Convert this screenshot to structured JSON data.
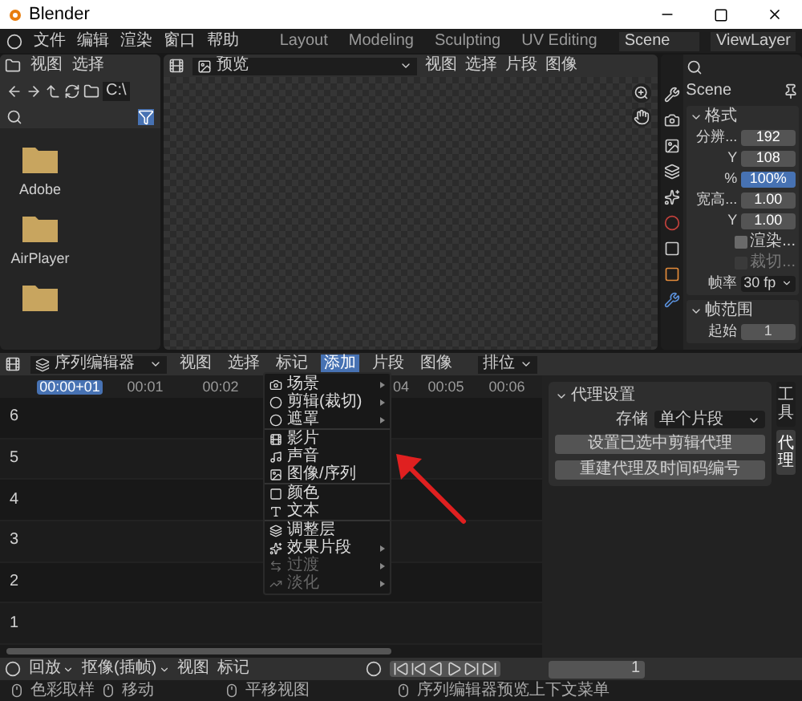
{
  "window": {
    "title": "Blender"
  },
  "menu": [
    "文件",
    "编辑",
    "渲染",
    "窗口",
    "帮助"
  ],
  "workspaces": [
    "Layout",
    "Modeling",
    "Sculpting",
    "UV Editing"
  ],
  "scene": "Scene",
  "view_layer": "ViewLayer",
  "file_browser": {
    "menu": [
      "视图",
      "选择"
    ],
    "path": "C:\\",
    "folders": [
      {
        "kind": "folder",
        "name": "Adobe"
      },
      {
        "kind": "folder",
        "name": "AirPlayer"
      },
      {
        "kind": "partial"
      }
    ]
  },
  "preview": {
    "editor": "预览",
    "menu": [
      "视图",
      "选择",
      "片段",
      "图像"
    ]
  },
  "properties": {
    "scene": "Scene",
    "format": {
      "title": "格式",
      "fields": [
        {
          "label": "分辨...",
          "value": "192",
          "kind": "number"
        },
        {
          "label": "Y",
          "value": "108",
          "kind": "number"
        },
        {
          "label": "%",
          "value": "100%",
          "kind": "slider",
          "level": 1
        },
        {
          "label": "宽高...",
          "value": "1.00",
          "kind": "number"
        },
        {
          "label": "Y",
          "value": "1.00",
          "kind": "number"
        },
        {
          "label": "渲染...",
          "kind": "checkbox",
          "checked": false,
          "disabled": false
        },
        {
          "label": "裁切...",
          "kind": "checkbox",
          "checked": false,
          "disabled": true
        },
        {
          "label": "帧率",
          "value": "30 fp",
          "kind": "dropdown"
        }
      ]
    },
    "frame_range": {
      "title": "帧范围",
      "fields": [
        {
          "label": "起始",
          "value": "1"
        }
      ]
    }
  },
  "sequencer": {
    "editor": "序列编辑器",
    "menu": [
      {
        "label": "视图",
        "selected": false
      },
      {
        "label": "选择",
        "selected": false
      },
      {
        "label": "标记",
        "selected": false
      },
      {
        "label": "添加",
        "selected": true
      },
      {
        "label": "片段",
        "selected": false
      },
      {
        "label": "图像",
        "selected": false
      }
    ],
    "pivot": "排位",
    "timecodes": [
      {
        "label": "00:00+01",
        "current": true
      },
      {
        "label": "00:01",
        "current": false
      },
      {
        "label": "00:02",
        "current": false
      },
      {
        "label": "04",
        "current": false
      },
      {
        "label": "00:05",
        "current": false
      },
      {
        "label": "00:06",
        "current": false
      }
    ],
    "channels": [
      "6",
      "5",
      "4",
      "3",
      "2",
      "1"
    ]
  },
  "add_menu": {
    "groups": [
      [
        {
          "label": "场景",
          "submenu": true,
          "disabled": false
        },
        {
          "label": "剪辑(裁切)",
          "submenu": true,
          "disabled": false
        },
        {
          "label": "遮罩",
          "submenu": true,
          "disabled": false
        }
      ],
      [
        {
          "label": "影片",
          "submenu": false,
          "disabled": false
        },
        {
          "label": "声音",
          "submenu": false,
          "disabled": false
        },
        {
          "label": "图像/序列",
          "submenu": false,
          "disabled": false
        }
      ],
      [
        {
          "label": "颜色",
          "submenu": false,
          "disabled": false
        },
        {
          "label": "文本",
          "submenu": false,
          "disabled": false
        }
      ],
      [
        {
          "label": "调整层",
          "submenu": false,
          "disabled": false
        },
        {
          "label": "效果片段",
          "submenu": true,
          "disabled": false
        },
        {
          "label": "过渡",
          "submenu": true,
          "disabled": true
        },
        {
          "label": "淡化",
          "submenu": true,
          "disabled": true
        }
      ]
    ]
  },
  "sidebar": {
    "panel": "代理设置",
    "storage_label": "存储",
    "storage": "单个片段",
    "buttons": [
      "设置已选中剪辑代理",
      "重建代理及时间码编号"
    ],
    "tabs": [
      {
        "label": "工具",
        "selected": false
      },
      {
        "label": "代理",
        "selected": true
      }
    ]
  },
  "timeline": {
    "menus": [
      "回放",
      "抠像(插帧)"
    ],
    "items": [
      "视图",
      "标记"
    ],
    "frame": "1"
  },
  "status_bar": [
    "色彩取样",
    "移动",
    "平移视图",
    "序列编辑器预览上下文菜单"
  ]
}
